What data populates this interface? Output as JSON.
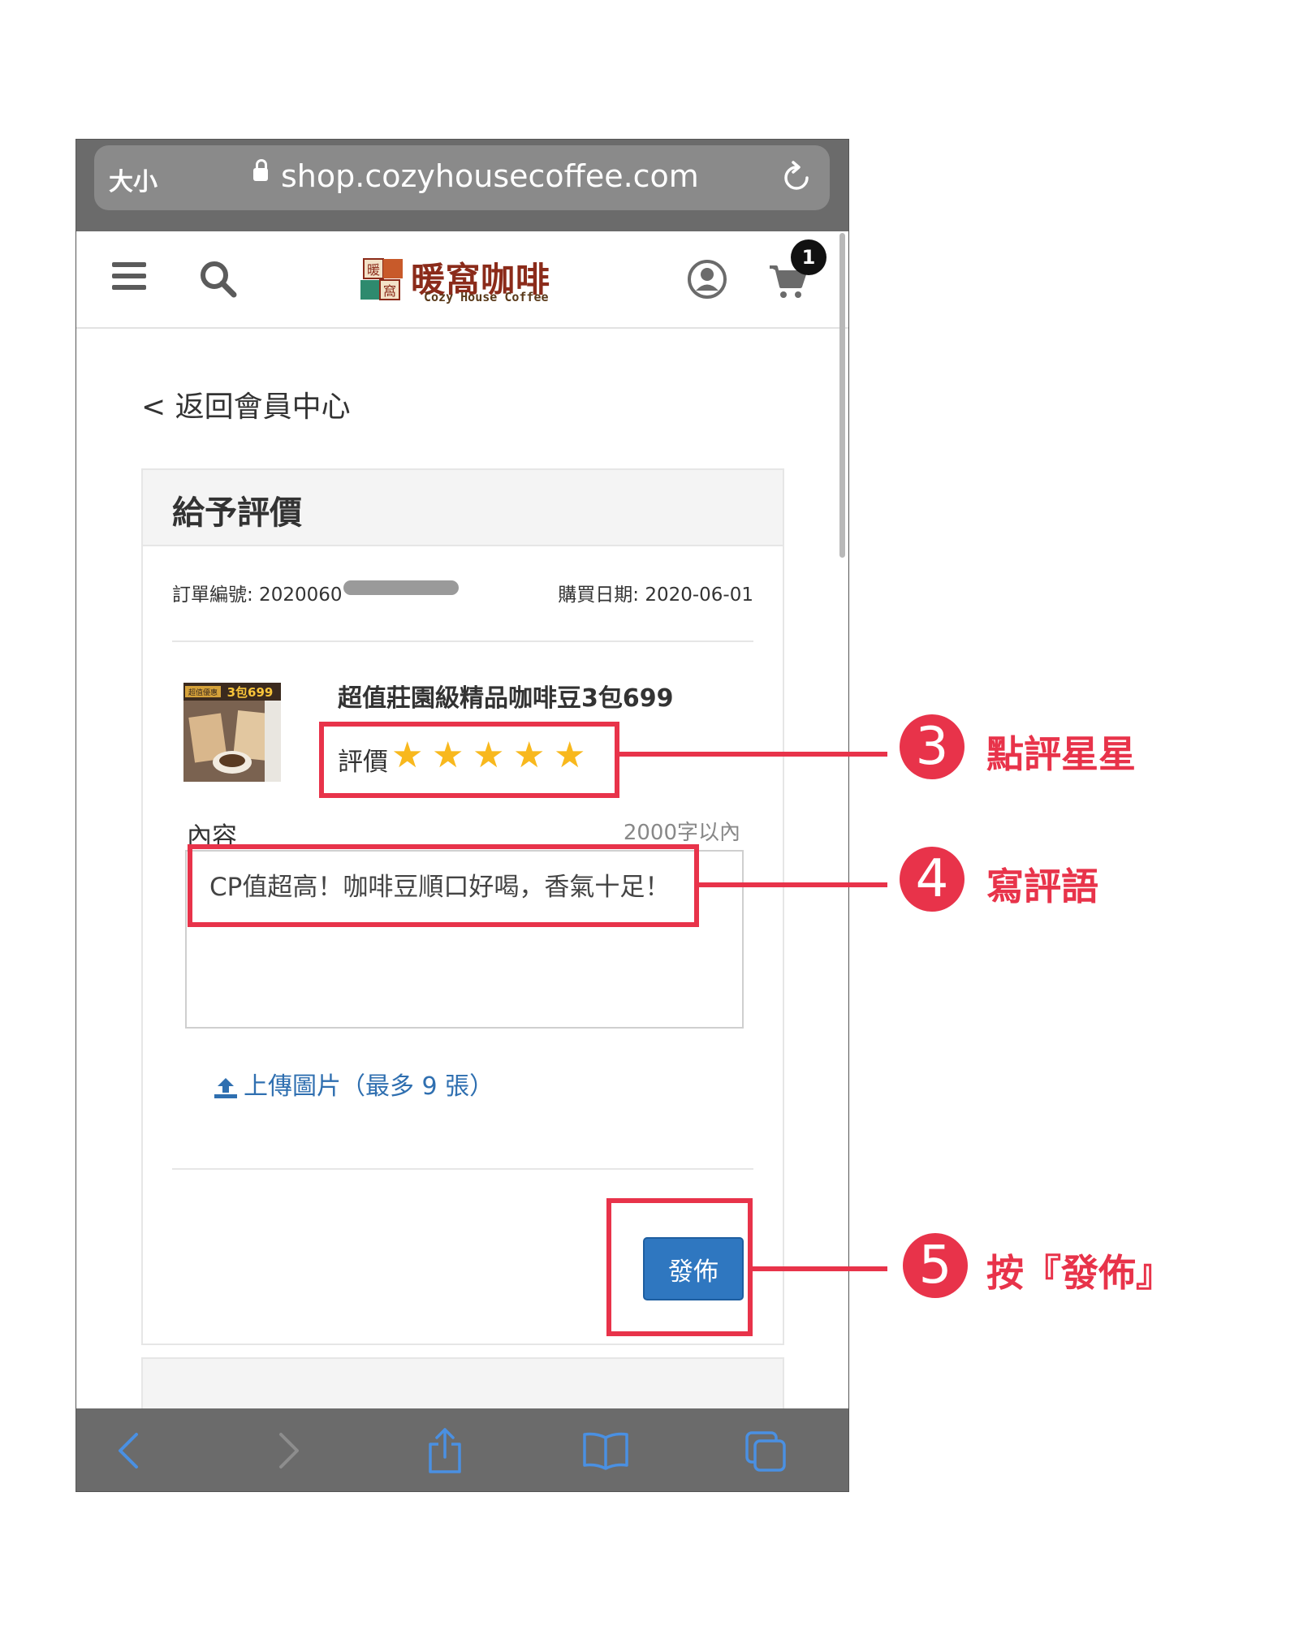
{
  "browser": {
    "text_size_label": "大小",
    "url": "shop.cozyhousecoffee.com"
  },
  "header": {
    "logo_cn": "暖窩咖啡",
    "logo_en": "Cozy House Coffee",
    "logo_mark": [
      "暖",
      "窩"
    ],
    "cart_count": "1"
  },
  "page": {
    "back_link": "< 返回會員中心",
    "card_title": "給予評價",
    "order_number": "訂單編號: 2020060",
    "purchase_date": "購買日期: 2020-06-01",
    "product_image_text": [
      "超值優惠",
      "3包699"
    ],
    "product_name": "超值莊園級精品咖啡豆3包699",
    "rating_label": "評價",
    "rating": 5,
    "rating_max": 5,
    "content_label": "內容",
    "char_limit": "2000字以內",
    "review_text": "CP值超高！咖啡豆順口好喝，香氣十足！",
    "upload_label": "上傳圖片（最多 9 張）",
    "publish_button": "發佈"
  },
  "annotations": [
    {
      "number": "3",
      "text": "點評星星"
    },
    {
      "number": "4",
      "text": "寫評語"
    },
    {
      "number": "5",
      "text": "按『發佈』"
    }
  ],
  "colors": {
    "annotation": "#e8334a",
    "star": "#f8b81d",
    "primary_button": "#2f77c0",
    "link": "#2f6fb0"
  }
}
